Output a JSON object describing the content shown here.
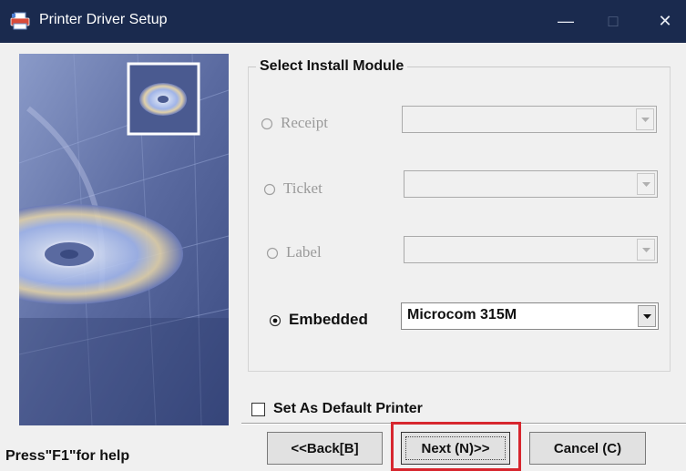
{
  "window": {
    "title": "Printer Driver Setup",
    "icons": {
      "app": "printer-icon",
      "minimize": "minimize-icon",
      "maximize": "maximize-icon",
      "close": "close-icon"
    },
    "minimize_glyph": "—",
    "maximize_glyph": "□",
    "close_glyph": "✕"
  },
  "group": {
    "title": "Select Install Module",
    "modules": [
      {
        "label": "Receipt",
        "selected": false,
        "enabled": false,
        "combo_value": ""
      },
      {
        "label": "Ticket",
        "selected": false,
        "enabled": false,
        "combo_value": ""
      },
      {
        "label": "Label",
        "selected": false,
        "enabled": false,
        "combo_value": ""
      },
      {
        "label": "Embedded",
        "selected": true,
        "enabled": true,
        "combo_value": "Microcom 315M"
      }
    ]
  },
  "default_printer": {
    "label": "Set As Default Printer",
    "checked": false
  },
  "help_text": "Press\"F1\"for help",
  "buttons": {
    "back": "<<Back[B]",
    "next": "Next (N)>>",
    "cancel": "Cancel (C)"
  },
  "colors": {
    "titlebar": "#1a2a4e",
    "highlight": "#d7262e",
    "dialog_bg": "#f0f0f0"
  }
}
